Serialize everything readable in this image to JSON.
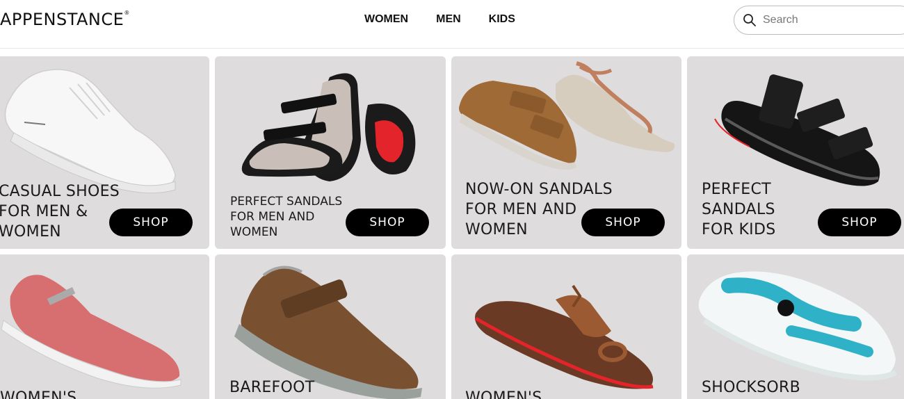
{
  "header": {
    "logo": "APPENSTANCE",
    "logo_mark": "®",
    "nav": [
      "WOMEN",
      "MEN",
      "KIDS"
    ],
    "search_placeholder": "Search"
  },
  "cards": [
    {
      "title": "CASUAL SHOES\nFOR MEN &\nWOMEN",
      "button": "SHOP",
      "product": "white sneaker"
    },
    {
      "title": "PERFECT SANDALS\nFOR MEN AND\nWOMEN",
      "button": "SHOP",
      "product": "black two-strap sandal"
    },
    {
      "title": "NOW-ON SANDALS\nFOR MEN AND\nWOMEN",
      "button": "SHOP",
      "product": "tan sandals"
    },
    {
      "title": "PERFECT\nSANDALS\nFOR KIDS",
      "button": "SHOP",
      "product": "black kids sandal"
    },
    {
      "title": "WOMEN'S",
      "product": "pink knit flat"
    },
    {
      "title": "BAREFOOT",
      "product": "brown barefoot shoe"
    },
    {
      "title": "WOMEN'S",
      "product": "brown kolhapuri sandal"
    },
    {
      "title": "SHOCKSORB",
      "product": "white and teal clog"
    }
  ],
  "colors": {
    "card_bg": "#dedcdd",
    "button_bg": "#000000",
    "button_text": "#ffffff",
    "accent_red": "#e3242b"
  }
}
